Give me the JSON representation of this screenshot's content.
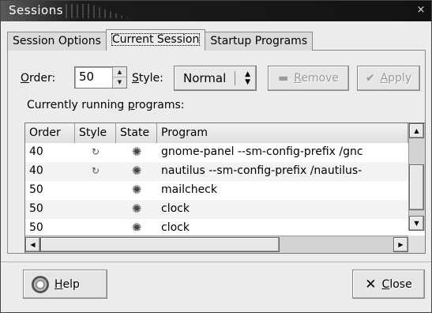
{
  "window": {
    "title": "Sessions",
    "close_glyph": "×"
  },
  "tabs": [
    {
      "label": "Session Options",
      "active": false
    },
    {
      "label": "Current Session",
      "active": true
    },
    {
      "label": "Startup Programs",
      "active": false
    }
  ],
  "controls": {
    "order_label_mnemonic": "O",
    "order_label_rest": "rder:",
    "order_value": "50",
    "style_label_mnemonic": "S",
    "style_label_rest": "tyle:",
    "style_value": "Normal",
    "remove_mnemonic": "R",
    "remove_rest": "emove",
    "remove_icon": "minus-icon",
    "apply_mnemonic": "A",
    "apply_rest": "pply",
    "apply_icon": "checkmark-icon",
    "buttons_enabled": false
  },
  "running": {
    "label_before": "Currently running ",
    "label_mnemonic": "p",
    "label_after": "rograms:"
  },
  "table": {
    "columns": [
      "Order",
      "Style",
      "State",
      "Program"
    ],
    "rows": [
      {
        "order": "40",
        "style_icon": "restart-arrows-icon",
        "state_icon": "gear-icon",
        "program": "gnome-panel --sm-config-prefix /gnc"
      },
      {
        "order": "40",
        "style_icon": "restart-arrows-icon",
        "state_icon": "gear-icon",
        "program": "nautilus --sm-config-prefix /nautilus-"
      },
      {
        "order": "50",
        "style_icon": "",
        "state_icon": "gear-icon",
        "program": "mailcheck"
      },
      {
        "order": "50",
        "style_icon": "",
        "state_icon": "gear-icon",
        "program": "clock"
      },
      {
        "order": "50",
        "style_icon": "",
        "state_icon": "gear-icon",
        "program": "clock"
      }
    ]
  },
  "footer": {
    "help_mnemonic": "H",
    "help_rest": "elp",
    "close_mnemonic": "C",
    "close_rest": "lose"
  }
}
